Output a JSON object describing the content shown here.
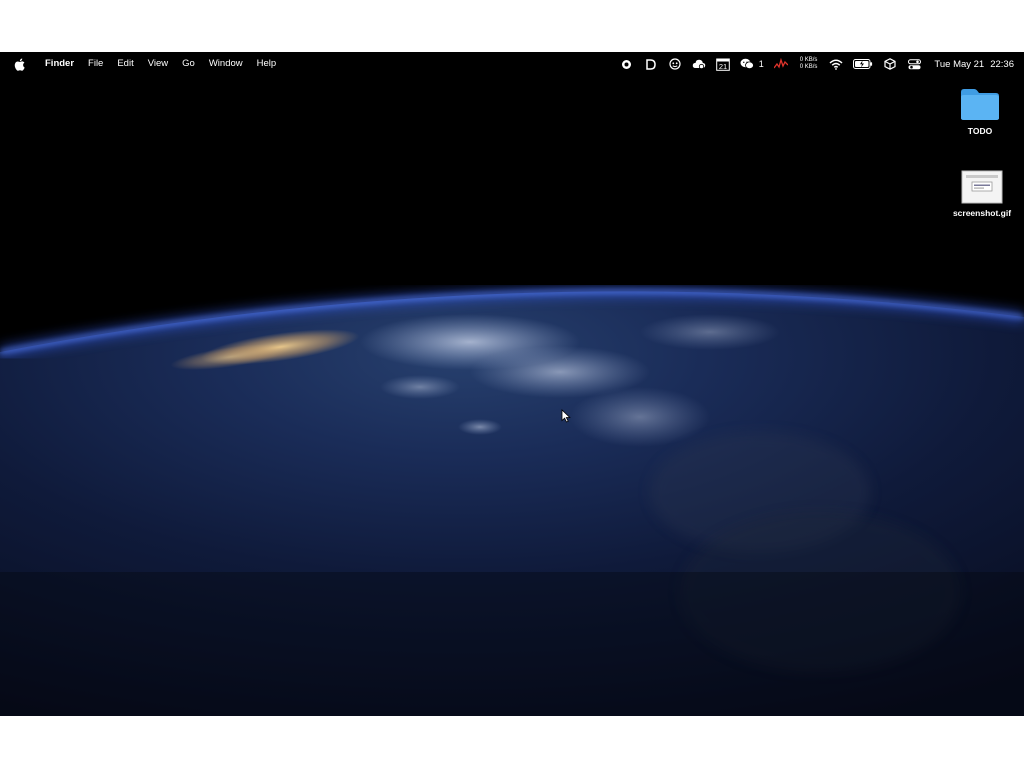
{
  "menubar": {
    "app_name": "Finder",
    "menus": [
      "File",
      "Edit",
      "View",
      "Go",
      "Window",
      "Help"
    ],
    "status_icons": [
      {
        "name": "record-icon"
      },
      {
        "name": "d-app-icon"
      },
      {
        "name": "qq-icon"
      },
      {
        "name": "cloud-app-icon"
      },
      {
        "name": "calendar-icon",
        "text": "21"
      },
      {
        "name": "wechat-icon",
        "badge": "1"
      },
      {
        "name": "activity-graph-icon"
      }
    ],
    "netspeed": {
      "up": "0 KB/s",
      "down": "0 KB/s"
    },
    "system_icons": [
      "wifi-icon",
      "battery-icon",
      "box-icon",
      "control-center-icon"
    ],
    "clock": {
      "date": "Tue May 21",
      "time": "22:36"
    }
  },
  "desktop": {
    "icons": [
      {
        "label": "TODO",
        "type": "folder"
      },
      {
        "label": "screenshot.gif",
        "type": "image-file"
      }
    ]
  },
  "colors": {
    "folder_blue": "#5BB4F3",
    "atmosphere_blue": "#2F5BFF",
    "sunlit_land": "#E8C27A"
  }
}
